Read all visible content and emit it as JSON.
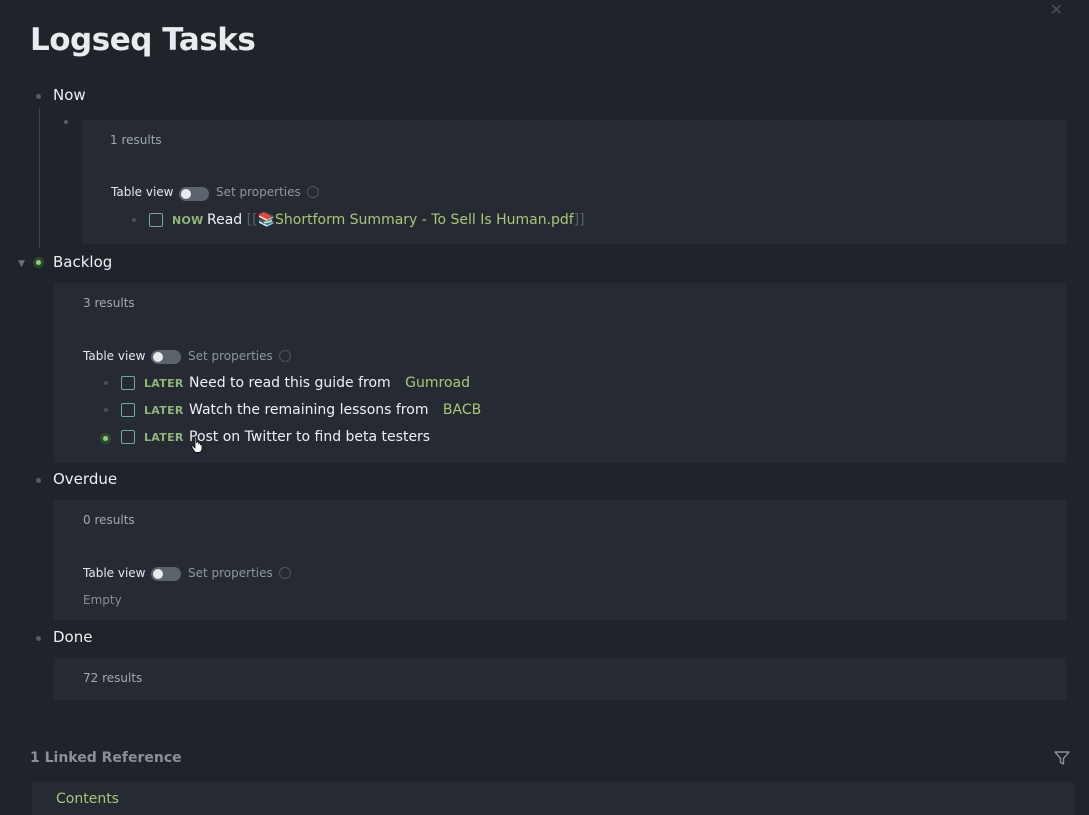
{
  "page": {
    "title": "Logseq Tasks"
  },
  "sections": {
    "now": {
      "label": "Now",
      "results": "1 results",
      "table_view": "Table view",
      "set_properties": "Set properties",
      "tasks": [
        {
          "marker": "NOW",
          "prefix": "Read",
          "ref_open": "[[",
          "ref_text": "📚Shortform Summary - To Sell Is Human.pdf",
          "ref_close": "]]"
        }
      ]
    },
    "backlog": {
      "label": "Backlog",
      "results": "3 results",
      "table_view": "Table view",
      "set_properties": "Set properties",
      "tasks": [
        {
          "marker": "LATER",
          "text": "Need to read this guide from",
          "ref": "Gumroad"
        },
        {
          "marker": "LATER",
          "text": "Watch the remaining lessons from",
          "ref": "BACB"
        },
        {
          "marker": "LATER",
          "text": "Post on Twitter to find beta testers"
        }
      ]
    },
    "overdue": {
      "label": "Overdue",
      "results": "0 results",
      "table_view": "Table view",
      "set_properties": "Set properties",
      "empty": "Empty"
    },
    "done": {
      "label": "Done",
      "results": "72 results"
    }
  },
  "linked_references": {
    "title": "1 Linked Reference",
    "contents_label": "Contents"
  },
  "icons": {
    "close": "close-icon",
    "filter": "filter-icon",
    "gear": "gear-icon",
    "collapse": "arrow-down-icon",
    "cursor": "cursor-icon"
  },
  "colors": {
    "background": "#1f232a",
    "panel": "#262b33",
    "accent_green": "#a8c878",
    "marker_green": "#8fb67a",
    "checkbox_teal": "#6fa8a2"
  }
}
